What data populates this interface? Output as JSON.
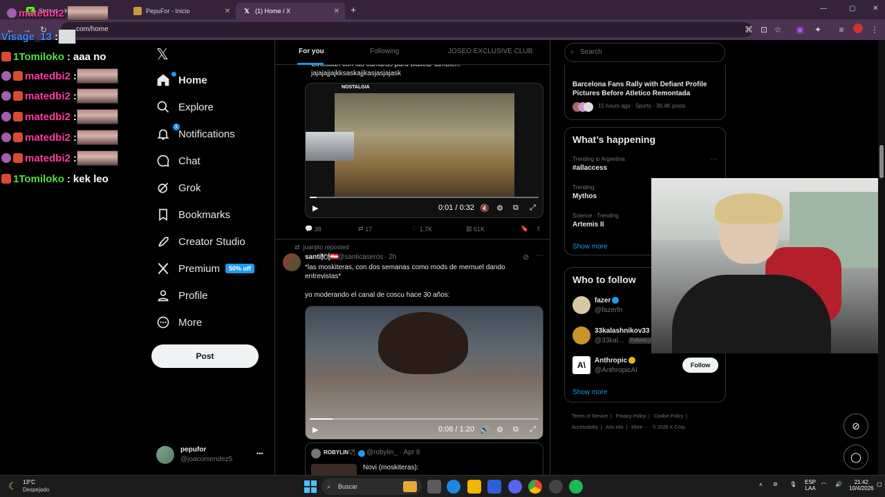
{
  "browser": {
    "tabs": [
      {
        "label": "Stream - Kick Dash",
        "active": false
      },
      {
        "label": "PepuFor - Inicio",
        "active": false
      },
      {
        "label": "(1) Home / X",
        "active": true
      }
    ],
    "new_tab": "+",
    "address": "com/home",
    "window_controls": [
      "—",
      "▢",
      "✕"
    ]
  },
  "chat": {
    "top_user": "matedbi2",
    "lines": [
      {
        "user": "Visage_13",
        "message": "",
        "color": "blue",
        "emote": true
      },
      {
        "user": "1Tomiloko",
        "message": "aaa no",
        "color": "green",
        "emote": false
      },
      {
        "user": "matedbi2",
        "message": "",
        "color": "pink",
        "emote": true
      },
      {
        "user": "matedbi2",
        "message": "",
        "color": "pink",
        "emote": true
      },
      {
        "user": "matedbi2",
        "message": "",
        "color": "pink",
        "emote": true
      },
      {
        "user": "matedbi2",
        "message": "",
        "color": "pink",
        "emote": true
      },
      {
        "user": "matedbi2",
        "message": "",
        "color": "pink",
        "emote": true
      },
      {
        "user": "1Tomiloko",
        "message": "kek leo",
        "color": "green",
        "emote": false
      }
    ]
  },
  "nav": {
    "items": [
      {
        "label": "Home",
        "icon": "home-icon"
      },
      {
        "label": "Explore",
        "icon": "search-icon"
      },
      {
        "label": "Notifications",
        "icon": "bell-icon",
        "badge": "1"
      },
      {
        "label": "Chat",
        "icon": "chat-icon"
      },
      {
        "label": "Grok",
        "icon": "grok-icon"
      },
      {
        "label": "Bookmarks",
        "icon": "bookmark-icon"
      },
      {
        "label": "Creator Studio",
        "icon": "rocket-icon"
      },
      {
        "label": "Premium",
        "icon": "x-logo-icon",
        "badge": "50% off"
      },
      {
        "label": "Profile",
        "icon": "person-icon"
      },
      {
        "label": "More",
        "icon": "more-circle-icon"
      }
    ],
    "post_label": "Post",
    "account": {
      "name": "pepufor",
      "handle": "@joacomendez5",
      "menu": "•••"
    }
  },
  "feed": {
    "tabs": [
      "For you",
      "Following",
      "JOSEO EXCLUSIVE CLUB"
    ],
    "post1": {
      "text_partial": "Cincuban con las camaras para wallear tambien.",
      "text": "jajajajjajkksaskajjkasjasjajask",
      "video_time": "0:01 / 0:32",
      "video_progress": 0.03,
      "overlay_brand": "NOSTALGIA",
      "actions": {
        "replies": "38",
        "reposts": "17",
        "likes": "1.7K",
        "views": "61K"
      }
    },
    "post2": {
      "repost_note": "juanjito reposted",
      "name": "santi🍽🇦🇹",
      "handle": "@santicaseros",
      "time": "· 2h",
      "text1": "*las moskiteras, con  dos semanas como mods de mernuel dando entrevistas*",
      "text2": "yo moderando el canal de coscu hace 30 años:",
      "video_time": "0:08 / 1:20",
      "video_progress": 0.1
    },
    "quote": {
      "name": "ROBYLIN🏹",
      "handle": "@robylin_",
      "time": "· Apr 8",
      "text": "Novi (moskiteras):"
    }
  },
  "right": {
    "search_placeholder": "Search",
    "news": {
      "title": "Barcelona Fans Rally with Defiant Profile Pictures Before Atletico Remontada",
      "meta": "15 hours ago · Sports · 36.4K posts"
    },
    "happening": {
      "title": "What’s happening",
      "trends": [
        {
          "meta": "Trending in Argentina",
          "name": "#allaccess"
        },
        {
          "meta": "Trending",
          "name": "Mythos"
        },
        {
          "meta": "Science · Trending",
          "name": "Artemis II"
        }
      ],
      "show_more": "Show more"
    },
    "who_to_follow": {
      "title": "Who to follow",
      "accounts": [
        {
          "name": "fazer",
          "handle": "@fazerfn",
          "verified": "blue"
        },
        {
          "name": "33kalashnikov33",
          "handle": "@33kal...",
          "note": "Follows y"
        },
        {
          "name": "Anthropic",
          "handle": "@AnthropicAI",
          "verified": "gold",
          "follow": "Follow"
        }
      ],
      "show_more": "Show more"
    },
    "footer": {
      "line1": [
        "Terms of Service",
        "|",
        "Privacy Policy",
        "|",
        "Cookie Policy",
        "|"
      ],
      "line2": [
        "Accessibility",
        "|",
        "Ads info",
        "|",
        "More ···",
        "© 2026 X Corp."
      ]
    }
  },
  "taskbar": {
    "weather_temp": "13°C",
    "weather_desc": "Despejado",
    "search": "Buscar",
    "lang": "ESP",
    "lang2": "LAA",
    "time": "21:42",
    "date": "10/4/2026"
  }
}
